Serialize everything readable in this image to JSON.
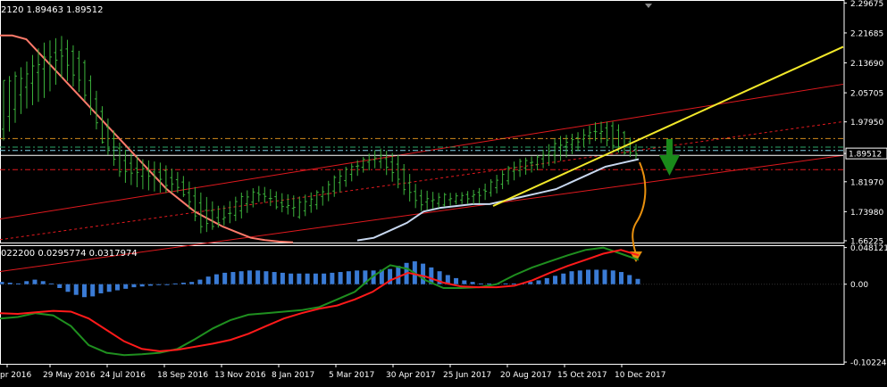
{
  "ohlc_readout": "2120 1.89463 1.89512",
  "macd_readout": "022200 0.0295774 0.0317974",
  "colors": {
    "background": "#000000",
    "grid": "#ffffff",
    "bar": "#3cb43c",
    "ma_salmon": "#ff7b6b",
    "ma_light": "#c8d8f0",
    "channel": "#e0191e",
    "trendline": "#f2e82a",
    "hline_orange": "#d38a1c",
    "hline_green": "#2ea86a",
    "hline_cyan": "#7fd0e6",
    "arrow_green": "#1a8a1a",
    "arrow_orange": "#e8900e",
    "macd_hist": "#3a7bd5",
    "macd_signal_red": "#ff1a1a",
    "macd_line_green": "#1f8f1f",
    "axis_text": "#ffffff"
  },
  "chart_data": [
    {
      "type": "line",
      "name": "main-price-chart",
      "y_ticks": [
        "2.29675",
        "2.21685",
        "2.13690",
        "2.05705",
        "1.97950",
        "1.89512",
        "1.81970",
        "1.73980",
        "1.66225"
      ],
      "current_price": "1.89512",
      "ylim": [
        1.655,
        2.3
      ],
      "x_labels": [
        "pr 2016",
        "29 May 2016",
        "24 Jul 2016",
        "18 Sep 2016",
        "13 Nov 2016",
        "8 Jan 2017",
        "5 Mar 2017",
        "30 Apr 2017",
        "25 Jun 2017",
        "20 Aug 2017",
        "15 Oct 2017",
        "10 Dec 2017"
      ],
      "price_bars_approx": [
        [
          1.96,
          1.93,
          2.09,
          2.09
        ],
        [
          2.06,
          2.01,
          2.13,
          2.1
        ],
        [
          2.12,
          2.04,
          2.19,
          2.15
        ],
        [
          2.18,
          2.1,
          2.21,
          2.15
        ],
        [
          2.15,
          2.05,
          2.16,
          2.07
        ],
        [
          2.0,
          1.92,
          2.02,
          1.93
        ],
        [
          1.89,
          1.82,
          1.91,
          1.84
        ],
        [
          1.84,
          1.8,
          1.88,
          1.85
        ],
        [
          1.85,
          1.79,
          1.87,
          1.82
        ],
        [
          1.82,
          1.79,
          1.84,
          1.8
        ],
        [
          1.76,
          1.68,
          1.79,
          1.7
        ],
        [
          1.72,
          1.7,
          1.75,
          1.71
        ],
        [
          1.74,
          1.72,
          1.79,
          1.78
        ],
        [
          1.79,
          1.77,
          1.81,
          1.79
        ],
        [
          1.77,
          1.74,
          1.79,
          1.75
        ],
        [
          1.73,
          1.72,
          1.78,
          1.76
        ],
        [
          1.77,
          1.75,
          1.8,
          1.79
        ],
        [
          1.81,
          1.79,
          1.85,
          1.84
        ],
        [
          1.86,
          1.84,
          1.88,
          1.87
        ],
        [
          1.88,
          1.86,
          1.91,
          1.89
        ],
        [
          1.87,
          1.8,
          1.89,
          1.82
        ],
        [
          1.78,
          1.74,
          1.8,
          1.76
        ],
        [
          1.76,
          1.75,
          1.79,
          1.78
        ],
        [
          1.77,
          1.76,
          1.79,
          1.78
        ],
        [
          1.79,
          1.76,
          1.8,
          1.78
        ],
        [
          1.8,
          1.79,
          1.84,
          1.83
        ],
        [
          1.85,
          1.83,
          1.88,
          1.87
        ],
        [
          1.87,
          1.85,
          1.89,
          1.88
        ],
        [
          1.9,
          1.87,
          1.94,
          1.92
        ],
        [
          1.93,
          1.9,
          1.95,
          1.93
        ],
        [
          1.95,
          1.93,
          1.98,
          1.96
        ],
        [
          1.97,
          1.9,
          1.98,
          1.91
        ],
        [
          1.91,
          1.88,
          1.92,
          1.89
        ]
      ],
      "ma_salmon_approx": [
        2.21,
        2.21,
        2.2,
        2.16,
        2.12,
        2.08,
        2.04,
        2.0,
        1.96,
        1.92,
        1.88,
        1.84,
        1.8,
        1.77,
        1.74,
        1.72,
        1.7,
        1.685,
        1.67,
        1.664,
        1.66,
        1.658
      ],
      "ma_light_approx": [
        1.663,
        1.67,
        1.69,
        1.71,
        1.74,
        1.75,
        1.755,
        1.76,
        1.76,
        1.77,
        1.78,
        1.79,
        1.8,
        1.82,
        1.84,
        1.86,
        1.87,
        1.88
      ],
      "trend_channel": {
        "upper": [
          1.72,
          2.08
        ],
        "lower_dashed": [
          1.665,
          1.98
        ],
        "lower": [
          1.58,
          1.89
        ]
      },
      "horizontal_levels": [
        {
          "value": 1.935,
          "style": "dash-dot",
          "color": "orange"
        },
        {
          "value": 1.912,
          "style": "dash-dot",
          "color": "green"
        },
        {
          "value": 1.903,
          "style": "dash-dot",
          "color": "cyan"
        },
        {
          "value": 1.89,
          "style": "solid",
          "color": "white"
        },
        {
          "value": 1.852,
          "style": "dash-dot",
          "color": "red"
        }
      ],
      "yellow_trendline": [
        1.755,
        2.18
      ],
      "arrow_down_green": true
    },
    {
      "type": "bar",
      "name": "macd-subpanel",
      "y_ticks": [
        "0.048121",
        "0.00",
        "-0.102244"
      ],
      "ylim": [
        -0.1045,
        0.05
      ],
      "histogram_approx": [
        0.003,
        0.002,
        0.001,
        0.004,
        0.006,
        0.004,
        0.001,
        -0.005,
        -0.01,
        -0.014,
        -0.017,
        -0.016,
        -0.012,
        -0.01,
        -0.008,
        -0.006,
        -0.004,
        -0.003,
        -0.002,
        -0.001,
        0.0,
        0.001,
        0.002,
        0.003,
        0.006,
        0.01,
        0.013,
        0.015,
        0.016,
        0.017,
        0.018,
        0.018,
        0.017,
        0.016,
        0.015,
        0.014,
        0.014,
        0.014,
        0.014,
        0.014,
        0.015,
        0.016,
        0.017,
        0.018,
        0.018,
        0.018,
        0.019,
        0.02,
        0.024,
        0.028,
        0.03,
        0.027,
        0.022,
        0.017,
        0.012,
        0.008,
        0.005,
        0.003,
        0.001,
        0.001,
        0.001,
        0.001,
        0.001,
        0.001,
        0.003,
        0.005,
        0.008,
        0.011,
        0.014,
        0.017,
        0.018,
        0.019,
        0.019,
        0.019,
        0.018,
        0.016,
        0.012,
        0.007
      ],
      "signal_red_approx": [
        -0.038,
        -0.039,
        -0.037,
        -0.035,
        -0.036,
        -0.045,
        -0.06,
        -0.075,
        -0.085,
        -0.088,
        -0.086,
        -0.082,
        -0.078,
        -0.073,
        -0.065,
        -0.055,
        -0.045,
        -0.038,
        -0.032,
        -0.028,
        -0.02,
        -0.01,
        0.005,
        0.015,
        0.01,
        0.002,
        -0.003,
        -0.004,
        -0.004,
        -0.002,
        0.005,
        0.015,
        0.024,
        0.032,
        0.04,
        0.045,
        0.038
      ],
      "macd_green_approx": [
        -0.045,
        -0.043,
        -0.038,
        -0.041,
        -0.055,
        -0.08,
        -0.09,
        -0.093,
        -0.092,
        -0.09,
        -0.085,
        -0.072,
        -0.058,
        -0.047,
        -0.04,
        -0.038,
        -0.036,
        -0.034,
        -0.03,
        -0.02,
        -0.01,
        0.01,
        0.025,
        0.02,
        0.005,
        -0.005,
        -0.005,
        -0.004,
        0.0,
        0.012,
        0.022,
        0.03,
        0.038,
        0.045,
        0.048,
        0.04,
        0.032
      ]
    }
  ]
}
